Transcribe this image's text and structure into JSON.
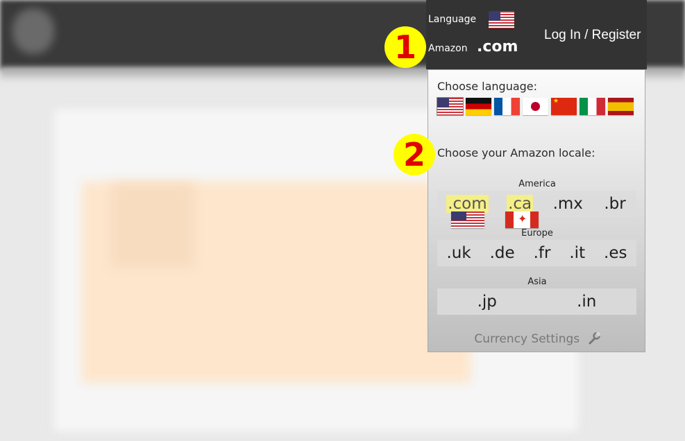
{
  "header": {
    "language_label": "Language",
    "amazon_label": "Amazon",
    "current_domain": ".com",
    "current_language_flag": "us-flag-icon",
    "login_label": "Log In / Register"
  },
  "panel": {
    "choose_language_label": "Choose language:",
    "language_flags": [
      "us-flag-icon",
      "germany-flag-icon",
      "france-flag-icon",
      "japan-flag-icon",
      "china-flag-icon",
      "italy-flag-icon",
      "spain-flag-icon"
    ],
    "choose_locale_label": "Choose your Amazon locale:",
    "regions": [
      {
        "name": "America",
        "locales": [
          ".com",
          ".ca",
          ".mx",
          ".br"
        ]
      },
      {
        "name": "Europe",
        "locales": [
          ".uk",
          ".de",
          ".fr",
          ".it",
          ".es"
        ]
      },
      {
        "name": "Asia",
        "locales": [
          ".jp",
          ".in"
        ]
      }
    ],
    "highlighted_locales": [
      ".com",
      ".ca"
    ],
    "currency_settings_label": "Currency Settings"
  },
  "annotations": {
    "badge1": "1",
    "badge2": "2"
  },
  "colors": {
    "header_bg": "#333333",
    "badge_bg": "#ffff00",
    "badge_text": "#e00000",
    "highlight": "#f5ef87"
  }
}
